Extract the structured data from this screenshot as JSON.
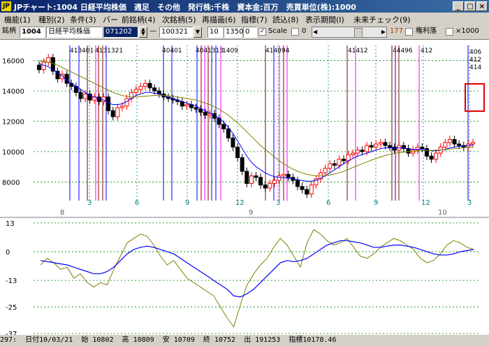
{
  "window": {
    "app_icon_label": "JP",
    "title": "JPチャート:1004 日経平均株価　週足　その他　発行株:千株　資本金:百万　売買単位(株):1000",
    "buttons": [
      "_",
      "□",
      "×"
    ]
  },
  "menu": [
    "機能(1)",
    "種別(2)",
    "条件(3)",
    "バー",
    "前銘柄(4)",
    "次銘柄(5)",
    "再描画(6)",
    "指標(7)",
    "読込(8)",
    "表示期間(I)",
    "未来チェック(9)"
  ],
  "toolbar": {
    "code_label": "銘柄",
    "code": "1004",
    "name": "日経平均株価",
    "date_from": "071202",
    "dash": "—",
    "date_to": "100321",
    "period": "10",
    "value1": "1350",
    "value2": "0",
    "scale_checked": true,
    "scale_label": "Scale",
    "scale_box_label": "0",
    "count": "177",
    "rights_label": "権利落",
    "x1000_label": "×1000"
  },
  "colors": {
    "accent": "#0a246a",
    "candle_up": "#ff0000",
    "candle_down": "#000000",
    "ma_short": "#0000ff",
    "ma_long": "#808000",
    "highlight": "#e00000"
  },
  "chart_data": [
    {
      "type": "candlestick",
      "y_ticks": [
        "16000",
        "14000",
        "12000",
        "10000",
        "8000"
      ],
      "ylim": [
        7000,
        17000
      ],
      "x_month_labels": [
        "3",
        "6",
        "9",
        "12",
        "3",
        "6",
        "9",
        "12",
        "3"
      ],
      "x_year_labels": [
        "8",
        "9",
        "10"
      ],
      "ohlc_close": [
        15400,
        15900,
        16200,
        15300,
        14800,
        15100,
        14500,
        14300,
        13900,
        13500,
        13800,
        13400,
        13600,
        13300,
        13600,
        12700,
        12300,
        12900,
        13000,
        13500,
        13900,
        14100,
        14300,
        14500,
        14200,
        14000,
        13800,
        13600,
        13500,
        13400,
        13300,
        13000,
        13100,
        12900,
        12800,
        12600,
        12400,
        12500,
        12200,
        11800,
        11500,
        10900,
        10300,
        9600,
        8700,
        7900,
        8400,
        8300,
        7800,
        7600,
        7900,
        8100,
        8400,
        8500,
        8300,
        8100,
        7700,
        7500,
        7200,
        7800,
        8200,
        8600,
        8900,
        9200,
        9100,
        9500,
        9400,
        9800,
        9900,
        10100,
        10000,
        10400,
        10300,
        10500,
        10600,
        10400,
        10300,
        10100,
        10400,
        10200,
        9900,
        10100,
        10300,
        10200,
        9700,
        9500,
        9900,
        10300,
        10600,
        10800,
        10500,
        10400,
        10300,
        10500,
        10600
      ],
      "ma13": [
        15800,
        15700,
        15600,
        15400,
        15200,
        15000,
        14700,
        14500,
        14300,
        14100,
        13900,
        13700,
        13600,
        13500,
        13400,
        13200,
        13100,
        13100,
        13150,
        13300,
        13500,
        13700,
        13800,
        13900,
        13900,
        13850,
        13800,
        13700,
        13600,
        13500,
        13400,
        13300,
        13200,
        13100,
        13000,
        12850,
        12700,
        12550,
        12400,
        12200,
        11950,
        11600,
        11200,
        10700,
        10200,
        9700,
        9300,
        9000,
        8800,
        8600,
        8450,
        8350,
        8300,
        8280,
        8250,
        8200,
        8150,
        8100,
        8050,
        8050,
        8100,
        8250,
        8400,
        8600,
        8800,
        9000,
        9200,
        9400,
        9550,
        9700,
        9800,
        9900,
        10000,
        10100,
        10200,
        10250,
        10250,
        10250,
        10250,
        10250,
        10200,
        10150,
        10150,
        10150,
        10100,
        10050,
        10050,
        10100,
        10150,
        10250,
        10300,
        10350,
        10350,
        10400,
        10450
      ],
      "ma26": [
        16000,
        15950,
        15900,
        15800,
        15700,
        15550,
        15400,
        15250,
        15100,
        14950,
        14800,
        14650,
        14500,
        14350,
        14200,
        14050,
        13900,
        13800,
        13700,
        13650,
        13600,
        13600,
        13620,
        13650,
        13680,
        13700,
        13720,
        13700,
        13680,
        13650,
        13600,
        13550,
        13500,
        13450,
        13400,
        13300,
        13200,
        13100,
        12950,
        12800,
        12600,
        12400,
        12150,
        11900,
        11600,
        11300,
        11000,
        10700,
        10400,
        10150,
        9900,
        9650,
        9400,
        9200,
        9000,
        8850,
        8700,
        8600,
        8500,
        8450,
        8400,
        8400,
        8420,
        8460,
        8520,
        8600,
        8700,
        8820,
        8950,
        9080,
        9200,
        9320,
        9440,
        9550,
        9650,
        9740,
        9820,
        9880,
        9930,
        9970,
        10000,
        10020,
        10040,
        10060,
        10070,
        10080,
        10090,
        10110,
        10140,
        10170,
        10200,
        10230,
        10260,
        10290,
        10320
      ]
    },
    {
      "type": "line",
      "y_ticks": [
        "13",
        "0",
        "-13",
        "-25",
        "-37"
      ],
      "ylim": [
        -37,
        13
      ],
      "series": [
        {
          "name": "",
          "values": [
            -6,
            -3,
            -5,
            -8,
            -7,
            -12,
            -10,
            -14,
            -16,
            -14,
            -15,
            -8,
            -2,
            4,
            6,
            8,
            7,
            3,
            -2,
            -6,
            -4,
            -8,
            -12,
            -14,
            -16,
            -18,
            -20,
            -25,
            -30,
            -34,
            -24,
            -15,
            -10,
            -6,
            -3,
            2,
            6,
            3,
            -2,
            -7,
            4,
            10,
            8,
            5,
            3,
            4,
            6,
            2,
            -2,
            -3,
            -1,
            2,
            4,
            6,
            5,
            3,
            1,
            -3,
            -5,
            -4,
            -1,
            3,
            5,
            4,
            2,
            1
          ]
        },
        {
          "name": "",
          "values": [
            -4,
            -4.5,
            -5,
            -5.5,
            -6,
            -7,
            -8,
            -9,
            -10,
            -10,
            -9,
            -7,
            -4,
            -1,
            1,
            2,
            2.5,
            2,
            1,
            0,
            -1,
            -3,
            -5,
            -7,
            -9,
            -11,
            -13,
            -15,
            -17,
            -20,
            -20.5,
            -19,
            -17,
            -14,
            -11,
            -8,
            -5,
            -4,
            -4.5,
            -4,
            -3,
            -1,
            1,
            3,
            4,
            5,
            5,
            4.5,
            4,
            3,
            2,
            2,
            2.5,
            3,
            3,
            2.5,
            2,
            1,
            0,
            -1,
            -1.5,
            -1.5,
            -1,
            0,
            0.5,
            1
          ]
        }
      ]
    }
  ],
  "event_codes": [
    "406",
    "412",
    "414"
  ],
  "event_labels_top": [
    "413401",
    "4131321",
    "40401",
    "4041313",
    "1409",
    "414094",
    "41412",
    "44496",
    "412"
  ],
  "status": {
    "index": "297:",
    "date_label": "日付",
    "date": "10/03/21",
    "open_label": "始",
    "open": "10802",
    "high_label": "高",
    "high": "10809",
    "low_label": "安",
    "low": "10709",
    "close_label": "終",
    "close": "10752",
    "volume_label": "出",
    "volume": "191253",
    "indicator_label": "指標",
    "indicator": "10178.46"
  }
}
